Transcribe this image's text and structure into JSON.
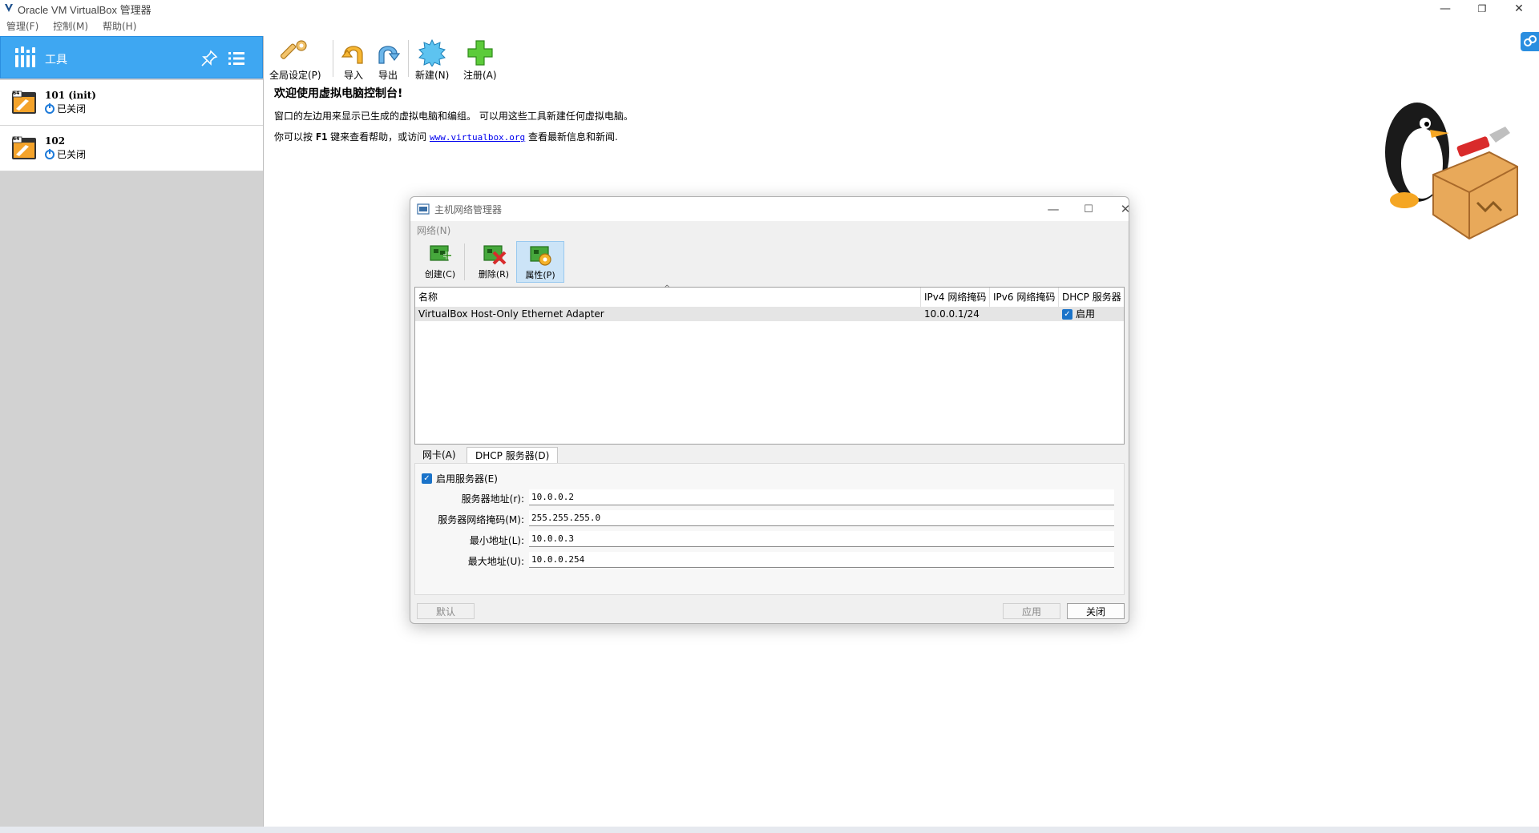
{
  "window": {
    "title": "Oracle VM VirtualBox 管理器",
    "controls": [
      "—",
      "❐",
      "✕"
    ]
  },
  "menubar": {
    "items": [
      "管理(F)",
      "控制(M)",
      "帮助(H)"
    ]
  },
  "sidebar": {
    "tools_label": "工具",
    "vms": [
      {
        "name": "101 (init)",
        "status": "已关闭",
        "badge": "64"
      },
      {
        "name": "102",
        "status": "已关闭",
        "badge": "64"
      }
    ]
  },
  "toolbar": {
    "global_settings": "全局设定(P)",
    "import": "导入",
    "export": "导出",
    "new": "新建(N)",
    "register": "注册(A)"
  },
  "welcome": {
    "title": "欢迎使用虚拟电脑控制台!",
    "line1": "窗口的左边用来显示已生成的虚拟电脑和编组。 可以用这些工具新建任何虚拟电脑。",
    "line2_pre": "你可以按",
    "line2_key": "F1",
    "line2_mid": "键来查看帮助，或访问",
    "link": "www.virtualbox.org",
    "line2_post": "查看最新信息和新闻."
  },
  "dialog": {
    "title": "主机网络管理器",
    "menu": "网络(N)",
    "toolbar": {
      "create": "创建(C)",
      "delete": "删除(R)",
      "properties": "属性(P)"
    },
    "table": {
      "headers": [
        "名称",
        "IPv4 网络掩码",
        "IPv6 网络掩码",
        "DHCP 服务器"
      ],
      "rows": [
        {
          "name": "VirtualBox Host-Only Ethernet Adapter",
          "ipv4": "10.0.0.1/24",
          "ipv6": "",
          "dhcp": "启用",
          "dhcp_checked": true
        }
      ]
    },
    "tabs": {
      "nic": "网卡(A)",
      "dhcp": "DHCP 服务器(D)",
      "active": "dhcp"
    },
    "dhcp": {
      "enable_label": "启用服务器(E)",
      "enabled": true,
      "server_address_label": "服务器地址(r):",
      "server_address": "10.0.0.2",
      "server_mask_label": "服务器网络掩码(M):",
      "server_mask": "255.255.255.0",
      "lower_label": "最小地址(L):",
      "lower": "10.0.0.3",
      "upper_label": "最大地址(U):",
      "upper": "10.0.0.254"
    },
    "buttons": {
      "default": "默认",
      "apply": "应用",
      "close": "关闭"
    }
  },
  "colors": {
    "accent": "#3ea7f2",
    "checkbox": "#1a73c9",
    "sidebar_bg": "#d2d2d2"
  }
}
